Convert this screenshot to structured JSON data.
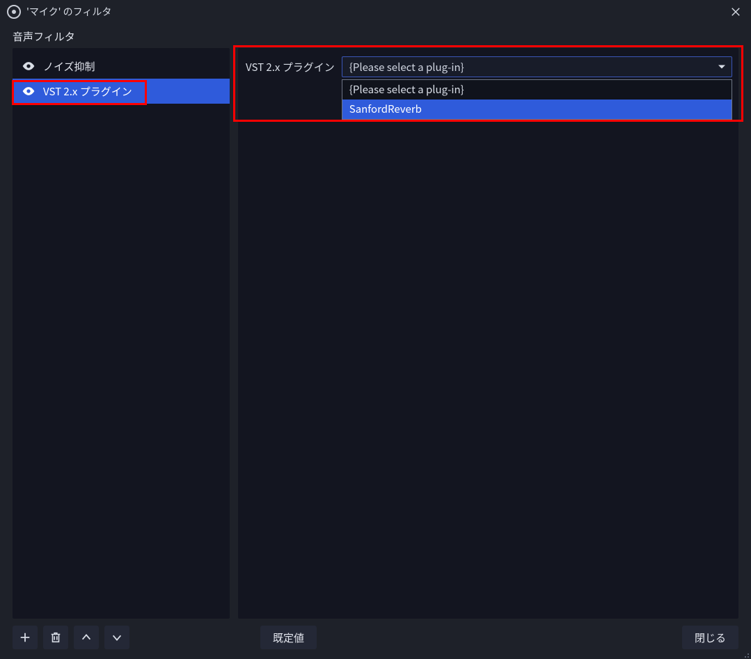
{
  "titlebar": {
    "title": "'マイク' のフィルタ"
  },
  "section_label": "音声フィルタ",
  "filters": {
    "items": [
      {
        "label": "ノイズ抑制",
        "selected": false
      },
      {
        "label": "VST 2.x プラグイン",
        "selected": true
      }
    ]
  },
  "properties": {
    "field_label": "VST 2.x プラグイン",
    "select_value": "{Please select a plug-in}",
    "dropdown": {
      "options": [
        {
          "label": "{Please select a plug-in}",
          "highlighted": false
        },
        {
          "label": "SanfordReverb",
          "highlighted": true
        }
      ]
    }
  },
  "footer": {
    "defaults_label": "既定値",
    "close_label": "閉じる"
  }
}
